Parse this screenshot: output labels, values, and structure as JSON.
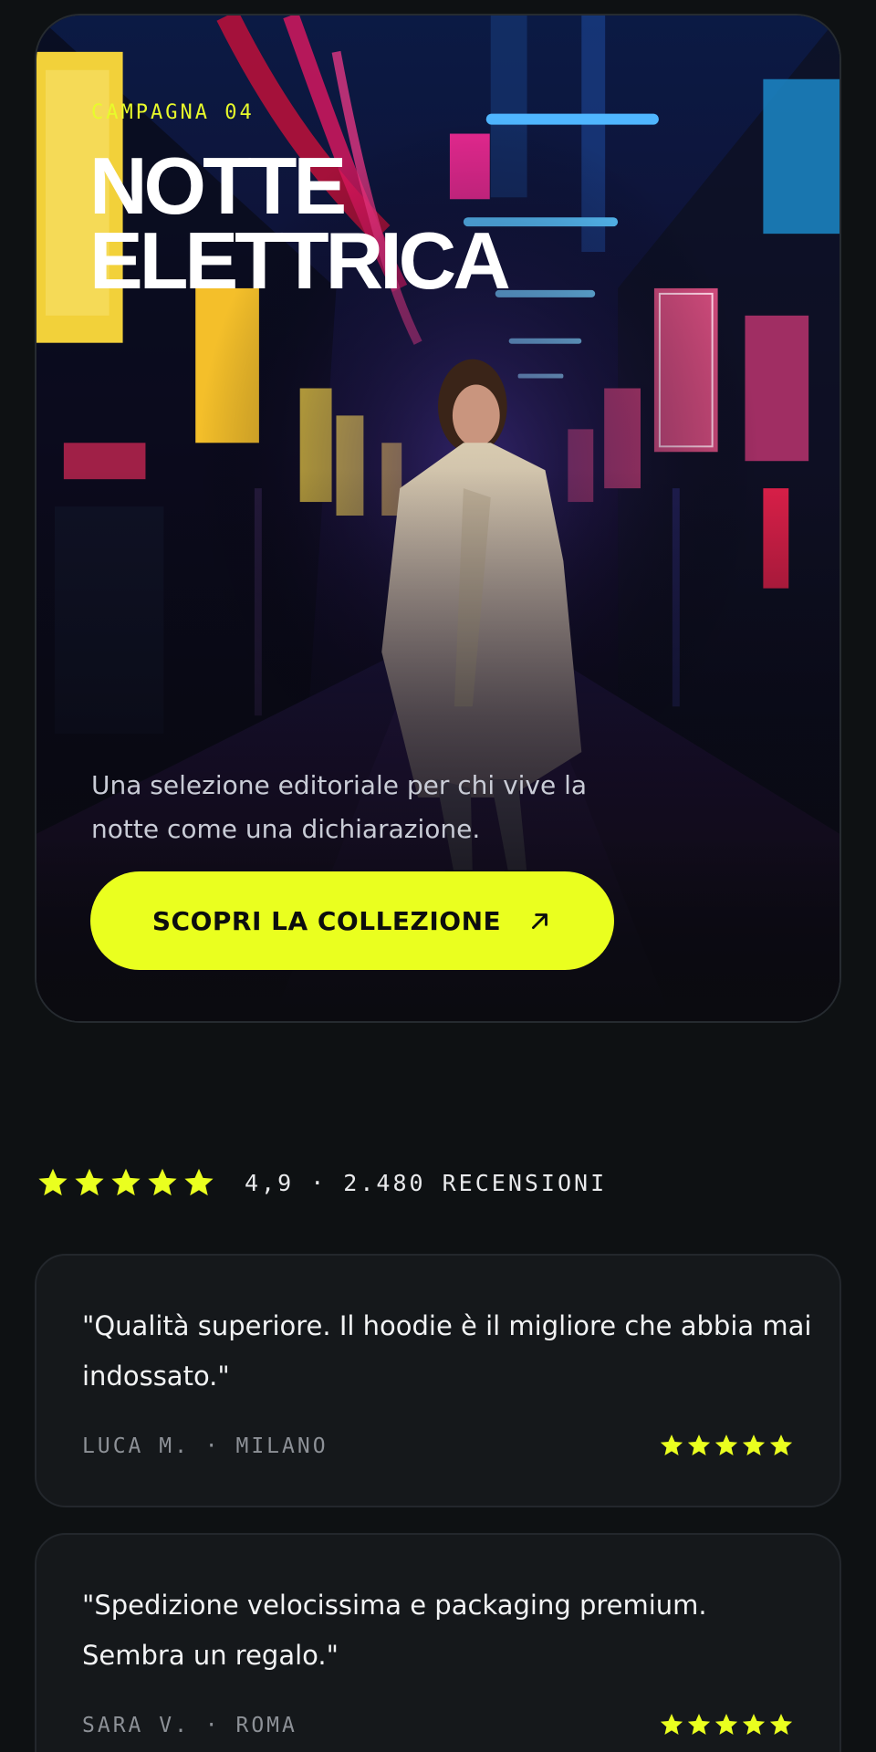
{
  "colors": {
    "background": "#0e1113",
    "accent": "#eaff1f",
    "card": "#15181b",
    "muted_text": "#8d9197"
  },
  "hero": {
    "eyebrow": "CAMPAGNA 04",
    "title_line1": "NOTTE",
    "title_line2": "ELETTRICA",
    "description": "Una selezione editoriale per chi vive la notte come una dichiarazione.",
    "cta_label": "SCOPRI LA COLLEZIONE",
    "cta_icon": "arrow-up-right-icon"
  },
  "rating": {
    "stars": 5,
    "text": "4,9 · 2.480 RECENSIONI"
  },
  "reviews": [
    {
      "quote": "\"Qualità superiore. Il hoodie è il migliore che abbia mai indossato.\"",
      "author": "LUCA M. · MILANO",
      "stars": 5
    },
    {
      "quote": "\"Spedizione velocissima e packaging premium. Sembra un regalo.\"",
      "author": "SARA V. · ROMA",
      "stars": 5
    }
  ]
}
